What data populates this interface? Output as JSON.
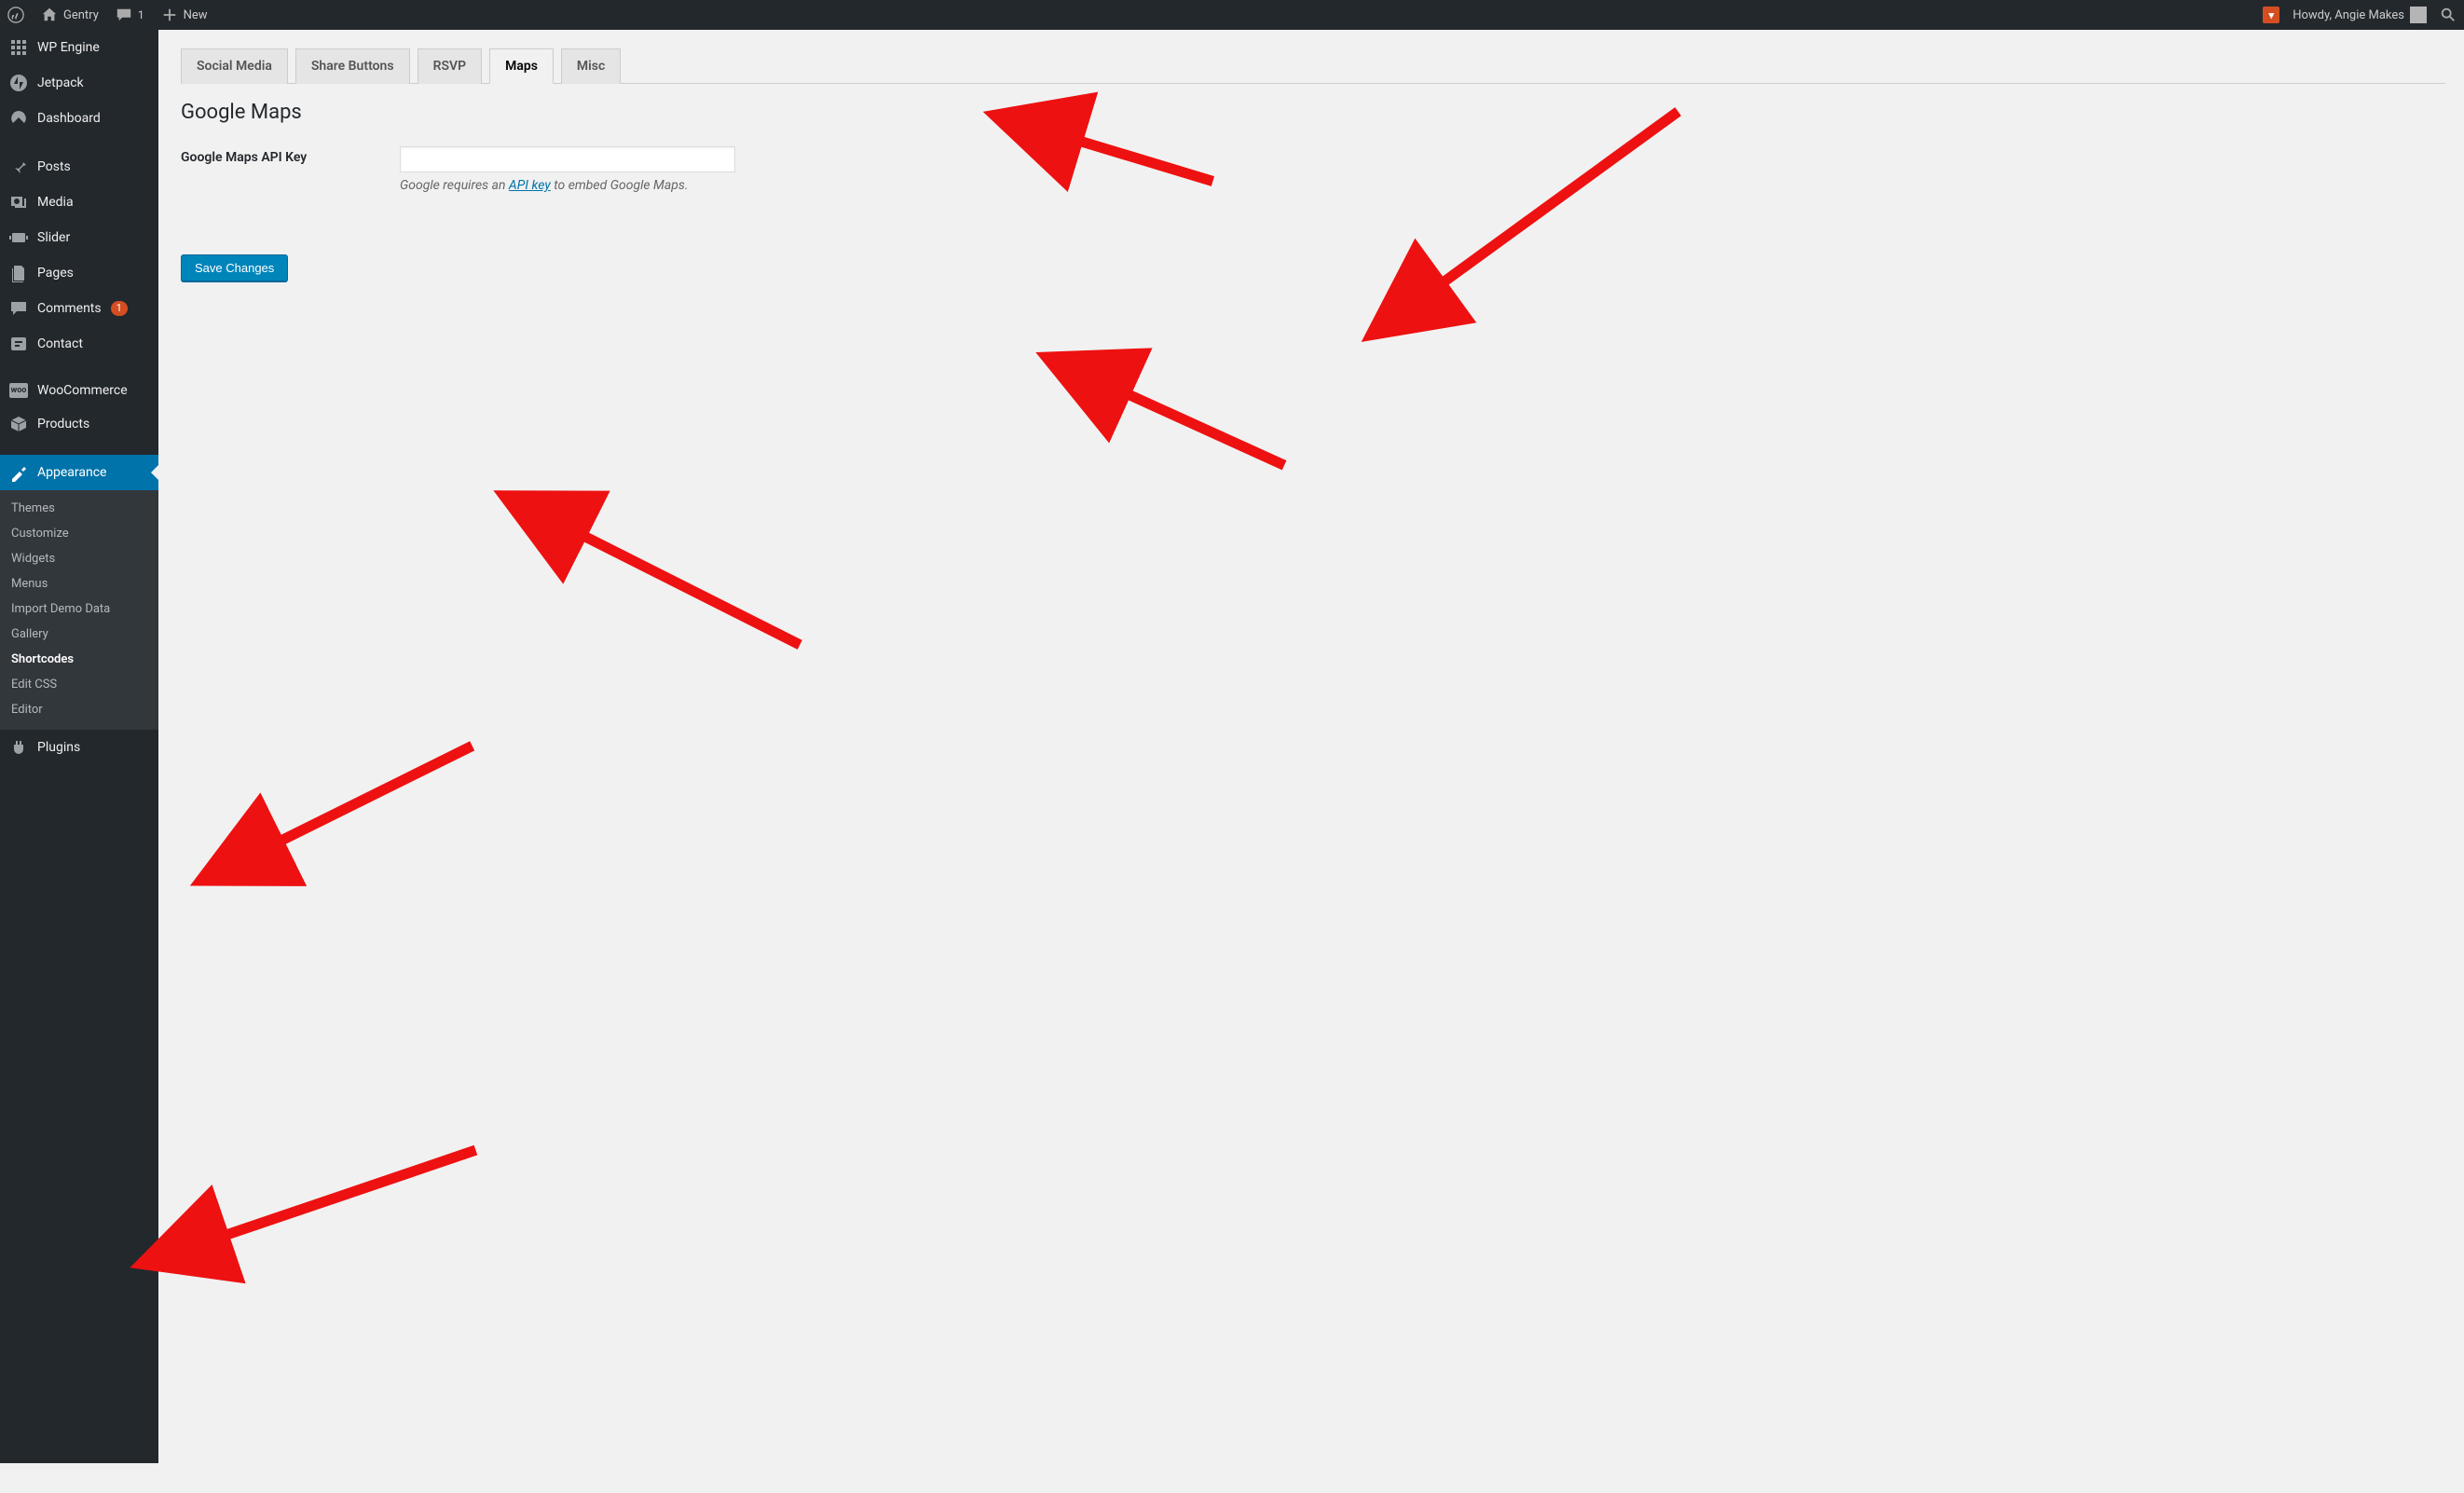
{
  "adminbar": {
    "site_name": "Gentry",
    "comment_count": "1",
    "new_label": "New",
    "howdy_prefix": "Howdy, ",
    "user_name": "Angie Makes"
  },
  "sidebar": {
    "items": [
      {
        "id": "wpengine",
        "label": "WP Engine"
      },
      {
        "id": "jetpack",
        "label": "Jetpack"
      },
      {
        "id": "dashboard",
        "label": "Dashboard"
      },
      {
        "id": "posts",
        "label": "Posts"
      },
      {
        "id": "media",
        "label": "Media"
      },
      {
        "id": "slider",
        "label": "Slider"
      },
      {
        "id": "pages",
        "label": "Pages"
      },
      {
        "id": "comments",
        "label": "Comments",
        "badge": "1"
      },
      {
        "id": "contact",
        "label": "Contact"
      },
      {
        "id": "woocommerce",
        "label": "WooCommerce"
      },
      {
        "id": "products",
        "label": "Products"
      },
      {
        "id": "appearance",
        "label": "Appearance",
        "current": true
      },
      {
        "id": "plugins",
        "label": "Plugins"
      }
    ],
    "appearance_submenu": [
      {
        "label": "Themes"
      },
      {
        "label": "Customize"
      },
      {
        "label": "Widgets"
      },
      {
        "label": "Menus"
      },
      {
        "label": "Import Demo Data"
      },
      {
        "label": "Gallery"
      },
      {
        "label": "Shortcodes",
        "current": true
      },
      {
        "label": "Edit CSS"
      },
      {
        "label": "Editor"
      }
    ]
  },
  "tabs": [
    {
      "label": "Social Media"
    },
    {
      "label": "Share Buttons"
    },
    {
      "label": "RSVP"
    },
    {
      "label": "Maps",
      "active": true
    },
    {
      "label": "Misc"
    }
  ],
  "page": {
    "section_title": "Google Maps",
    "api_key_label": "Google Maps API Key",
    "api_key_value": "",
    "helper_before": "Google requires an ",
    "helper_link_text": "API key",
    "helper_after": " to embed Google Maps.",
    "save_button": "Save Changes"
  }
}
